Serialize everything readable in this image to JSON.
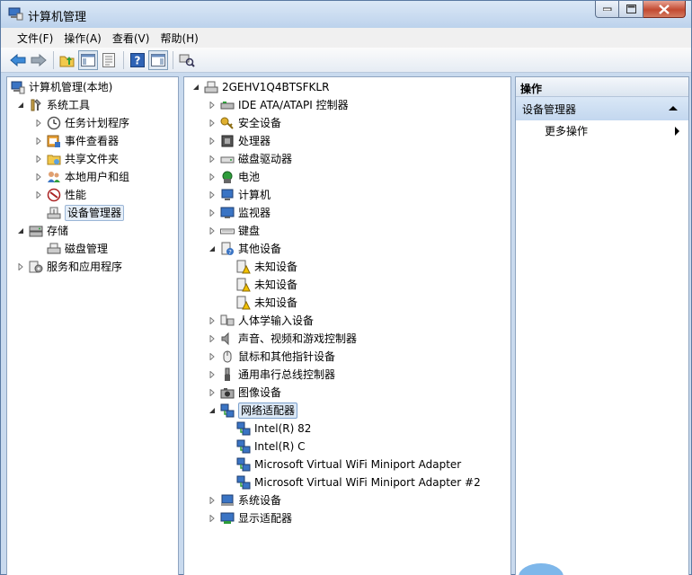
{
  "window": {
    "title": "计算机管理"
  },
  "menu": [
    "文件(F)",
    "操作(A)",
    "查看(V)",
    "帮助(H)"
  ],
  "toolbar_icons": [
    "back-arrow-icon",
    "forward-arrow-icon",
    "up-folder-icon",
    "show-hide-tree-icon",
    "properties-icon",
    "help-icon",
    "action-pane-icon",
    "scan-hardware-icon"
  ],
  "left_tree": {
    "root": "计算机管理(本地)",
    "system_tools": "系统工具",
    "task_scheduler": "任务计划程序",
    "event_viewer": "事件查看器",
    "shared_folders": "共享文件夹",
    "local_users": "本地用户和组",
    "performance": "性能",
    "device_manager": "设备管理器",
    "storage": "存储",
    "disk_management": "磁盘管理",
    "services": "服务和应用程序"
  },
  "device_tree": {
    "computer_name": "2GEHV1Q4BTSFKLR",
    "categories": {
      "ide": "IDE ATA/ATAPI 控制器",
      "security": "安全设备",
      "processor": "处理器",
      "disk": "磁盘驱动器",
      "battery": "电池",
      "computer": "计算机",
      "monitor": "监视器",
      "keyboard": "键盘",
      "other": "其他设备",
      "hid": "人体学输入设备",
      "sound": "声音、视频和游戏控制器",
      "mouse": "鼠标和其他指针设备",
      "usb": "通用串行总线控制器",
      "imaging": "图像设备",
      "network": "网络适配器",
      "system": "系统设备",
      "display": "显示适配器"
    },
    "other_children": [
      "未知设备",
      "未知设备",
      "未知设备"
    ],
    "network_children": [
      "Intel(R) 82",
      "Intel(R) C",
      "Microsoft Virtual WiFi Miniport Adapter",
      "Microsoft Virtual WiFi Miniport Adapter #2"
    ]
  },
  "actions": {
    "header": "操作",
    "section": "设备管理器",
    "more": "更多操作"
  },
  "colors": {
    "title_bar": "#c9daee",
    "close_button": "#c24a31",
    "selection": "#dce8f5"
  }
}
